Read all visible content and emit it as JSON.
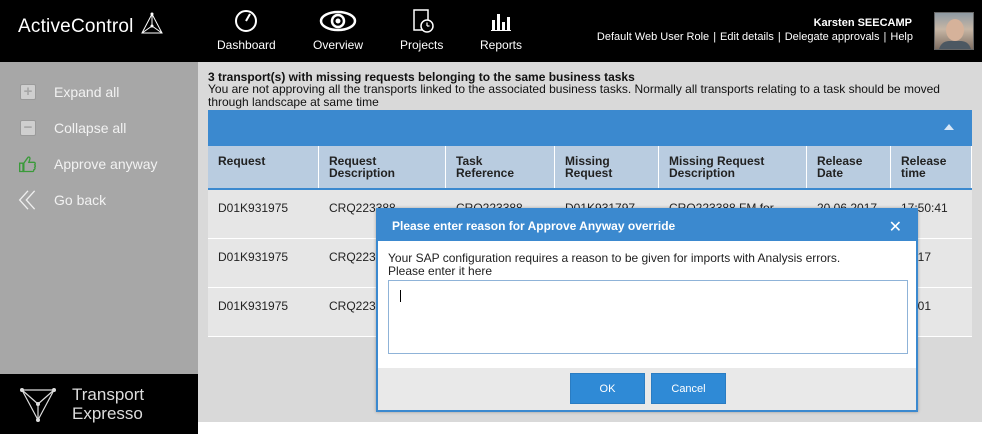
{
  "app": {
    "name": "ActiveControl"
  },
  "nav": [
    {
      "label": "Dashboard",
      "icon": "gauge-icon"
    },
    {
      "label": "Overview",
      "icon": "eye-icon"
    },
    {
      "label": "Projects",
      "icon": "document-clock-icon"
    },
    {
      "label": "Reports",
      "icon": "bar-chart-icon"
    }
  ],
  "user": {
    "name": "Karsten SEECAMP",
    "links": [
      "Default Web User Role",
      "Edit details",
      "Delegate approvals",
      "Help"
    ],
    "separator": "|"
  },
  "sidebar": {
    "items": [
      {
        "label": "Expand all",
        "icon": "plus-square-icon"
      },
      {
        "label": "Collapse all",
        "icon": "minus-square-icon"
      },
      {
        "label": "Approve anyway",
        "icon": "thumbs-up-icon"
      },
      {
        "label": "Go back",
        "icon": "double-chevron-left-icon"
      }
    ],
    "brand": {
      "line1": "Transport",
      "line2": "Expresso"
    }
  },
  "main": {
    "title": "3 transport(s) with missing requests belonging to the same business tasks",
    "description": "You are not approving all the transports linked to the associated business tasks. Normally all transports relating to a task should be moved through landscape at same time",
    "table": {
      "headers": [
        [
          "Request",
          ""
        ],
        [
          "Request",
          "Description"
        ],
        [
          "Task",
          "Reference"
        ],
        [
          "Missing",
          "Request"
        ],
        [
          "Missing Request",
          "Description"
        ],
        [
          "Release",
          "Date"
        ],
        [
          "Release",
          "time"
        ]
      ],
      "rows": [
        [
          "D01K931975",
          "CRQ223388",
          "CRQ223388",
          "D01K931797",
          "CRQ223388 FM for",
          "20.06.2017",
          "17:50:41"
        ],
        [
          "D01K931975",
          "CRQ223",
          "",
          "",
          "",
          "",
          "51:17"
        ],
        [
          "D01K931975",
          "CRQ223",
          "",
          "",
          "",
          "",
          "57:01"
        ]
      ]
    }
  },
  "modal": {
    "title": "Please enter reason for Approve Anyway override",
    "close": "✕",
    "line1": "Your SAP configuration requires a reason to be given for imports with Analysis errors.",
    "line2": "Please enter it here",
    "input_value": "",
    "ok_label": "OK",
    "cancel_label": "Cancel"
  },
  "colors": {
    "accent": "#3b89cf",
    "topbar": "#000000",
    "sidebar": "#a7a7a7"
  }
}
